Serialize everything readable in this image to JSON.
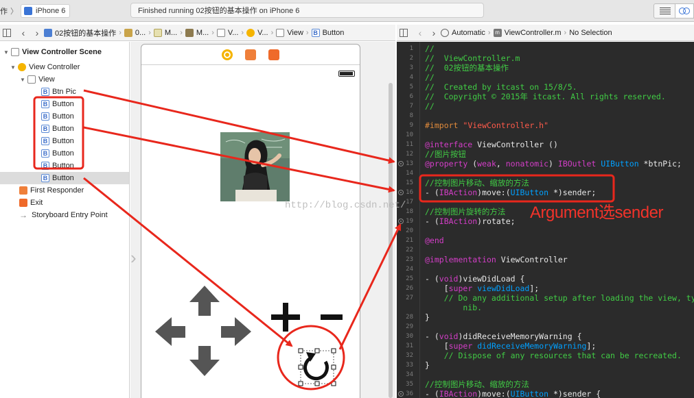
{
  "toolbar": {
    "scheme_name": "作",
    "device": "iPhone 6",
    "status": "Finished running 02按钮的基本操作 on iPhone 6"
  },
  "jump_left": {
    "items": [
      "02按钮的基本操作",
      "0...",
      "M...",
      "M...",
      "V...",
      "V...",
      "View",
      "Button"
    ]
  },
  "jump_right": {
    "automatic": "Automatic",
    "file": "ViewController.m",
    "selection": "No Selection"
  },
  "outline": {
    "scene": "View Controller Scene",
    "controller": "View Controller",
    "view": "View",
    "children": [
      "Btn Pic",
      "Button",
      "Button",
      "Button",
      "Button",
      "Button",
      "Button",
      "Button"
    ],
    "first_responder": "First Responder",
    "exit": "Exit",
    "entry_point": "Storyboard Entry Point"
  },
  "canvas": {
    "controls": [
      "arrow-up",
      "arrow-left",
      "arrow-right",
      "arrow-down",
      "plus",
      "minus",
      "rotate"
    ]
  },
  "code": [
    {
      "ln": "1",
      "segs": [
        {
          "t": "//",
          "c": "comment"
        }
      ]
    },
    {
      "ln": "2",
      "segs": [
        {
          "t": "//  ViewController.m",
          "c": "comment"
        }
      ]
    },
    {
      "ln": "3",
      "segs": [
        {
          "t": "//  02按钮的基本操作",
          "c": "comment"
        }
      ]
    },
    {
      "ln": "4",
      "segs": [
        {
          "t": "//",
          "c": "comment"
        }
      ]
    },
    {
      "ln": "5",
      "segs": [
        {
          "t": "//  Created by itcast on 15/8/5.",
          "c": "comment"
        }
      ]
    },
    {
      "ln": "6",
      "segs": [
        {
          "t": "//  Copyright © 2015年 itcast. All rights reserved.",
          "c": "comment"
        }
      ]
    },
    {
      "ln": "7",
      "segs": [
        {
          "t": "//",
          "c": "comment"
        }
      ]
    },
    {
      "ln": "8",
      "segs": []
    },
    {
      "ln": "9",
      "segs": [
        {
          "t": "#import ",
          "c": "preproc"
        },
        {
          "t": "\"ViewController.h\"",
          "c": "string"
        }
      ]
    },
    {
      "ln": "10",
      "segs": []
    },
    {
      "ln": "11",
      "segs": [
        {
          "t": "@interface",
          "c": "keyword"
        },
        {
          "t": " ViewController ()",
          "c": "plain"
        }
      ]
    },
    {
      "ln": "12",
      "segs": [
        {
          "t": "//图片按钮",
          "c": "comment"
        }
      ]
    },
    {
      "ln": "13",
      "bp": true,
      "segs": [
        {
          "t": "@property",
          "c": "keyword"
        },
        {
          "t": " (",
          "c": "plain"
        },
        {
          "t": "weak",
          "c": "keyword"
        },
        {
          "t": ", ",
          "c": "plain"
        },
        {
          "t": "nonatomic",
          "c": "keyword"
        },
        {
          "t": ") ",
          "c": "plain"
        },
        {
          "t": "IBOutlet",
          "c": "keyword"
        },
        {
          "t": " ",
          "c": "plain"
        },
        {
          "t": "UIButton",
          "c": "type"
        },
        {
          "t": " *btnPic;",
          "c": "plain"
        }
      ]
    },
    {
      "ln": "14",
      "segs": []
    },
    {
      "ln": "15",
      "segs": [
        {
          "t": "//控制图片移动、缩放的方法",
          "c": "comment"
        }
      ]
    },
    {
      "ln": "16",
      "bp": true,
      "segs": [
        {
          "t": "- (",
          "c": "plain"
        },
        {
          "t": "IBAction",
          "c": "keyword"
        },
        {
          "t": ")move:(",
          "c": "plain"
        },
        {
          "t": "UIButton",
          "c": "type"
        },
        {
          "t": " *)sender;",
          "c": "plain"
        }
      ]
    },
    {
      "ln": "17",
      "segs": []
    },
    {
      "ln": "18",
      "segs": [
        {
          "t": "//控制图片旋转的方法",
          "c": "comment"
        }
      ]
    },
    {
      "ln": "19",
      "bp": true,
      "segs": [
        {
          "t": "- (",
          "c": "plain"
        },
        {
          "t": "IBAction",
          "c": "keyword"
        },
        {
          "t": ")rotate;",
          "c": "plain"
        }
      ]
    },
    {
      "ln": "20",
      "segs": []
    },
    {
      "ln": "21",
      "segs": [
        {
          "t": "@end",
          "c": "keyword"
        }
      ]
    },
    {
      "ln": "22",
      "segs": []
    },
    {
      "ln": "23",
      "segs": [
        {
          "t": "@implementation",
          "c": "keyword"
        },
        {
          "t": " ViewController",
          "c": "plain"
        }
      ]
    },
    {
      "ln": "24",
      "segs": []
    },
    {
      "ln": "25",
      "segs": [
        {
          "t": "- (",
          "c": "plain"
        },
        {
          "t": "void",
          "c": "keyword"
        },
        {
          "t": ")viewDidLoad {",
          "c": "plain"
        }
      ]
    },
    {
      "ln": "26",
      "segs": [
        {
          "t": "    [",
          "c": "plain"
        },
        {
          "t": "super",
          "c": "keyword"
        },
        {
          "t": " ",
          "c": "plain"
        },
        {
          "t": "viewDidLoad",
          "c": "type"
        },
        {
          "t": "];",
          "c": "plain"
        }
      ]
    },
    {
      "ln": "27",
      "segs": [
        {
          "t": "    // Do any additional setup after loading the view, typically from a",
          "c": "comment"
        }
      ]
    },
    {
      "ln": "",
      "segs": [
        {
          "t": "        nib.",
          "c": "comment"
        }
      ]
    },
    {
      "ln": "28",
      "segs": [
        {
          "t": "}",
          "c": "plain"
        }
      ]
    },
    {
      "ln": "29",
      "segs": []
    },
    {
      "ln": "30",
      "segs": [
        {
          "t": "- (",
          "c": "plain"
        },
        {
          "t": "void",
          "c": "keyword"
        },
        {
          "t": ")didReceiveMemoryWarning {",
          "c": "plain"
        }
      ]
    },
    {
      "ln": "31",
      "segs": [
        {
          "t": "    [",
          "c": "plain"
        },
        {
          "t": "super",
          "c": "keyword"
        },
        {
          "t": " ",
          "c": "plain"
        },
        {
          "t": "didReceiveMemoryWarning",
          "c": "type"
        },
        {
          "t": "];",
          "c": "plain"
        }
      ]
    },
    {
      "ln": "32",
      "segs": [
        {
          "t": "    // Dispose of any resources that can be recreated.",
          "c": "comment"
        }
      ]
    },
    {
      "ln": "33",
      "segs": [
        {
          "t": "}",
          "c": "plain"
        }
      ]
    },
    {
      "ln": "34",
      "segs": []
    },
    {
      "ln": "35",
      "segs": [
        {
          "t": "//控制图片移动、缩放的方法",
          "c": "comment"
        }
      ]
    },
    {
      "ln": "36",
      "bp": true,
      "segs": [
        {
          "t": "- (",
          "c": "plain"
        },
        {
          "t": "IBAction",
          "c": "keyword"
        },
        {
          "t": ")move:(",
          "c": "plain"
        },
        {
          "t": "UIButton",
          "c": "type"
        },
        {
          "t": " *)sender {",
          "c": "plain"
        }
      ]
    }
  ],
  "annotation": {
    "note": "Argument选sender",
    "watermark": "http://blog.csdn.net/",
    "color": "#e8271c"
  },
  "colors": {
    "editor_bg": "#2b2b2b",
    "comment": "#41cc45",
    "keyword": "#d43ec8",
    "type": "#00a0ff",
    "string": "#ff5a4a",
    "preproc": "#e08a3b"
  },
  "icons": [
    "grid-icon",
    "back-icon",
    "forward-icon",
    "view-controller-icon",
    "first-responder-icon",
    "exit-icon",
    "battery-icon",
    "breakpoint-icon"
  ]
}
